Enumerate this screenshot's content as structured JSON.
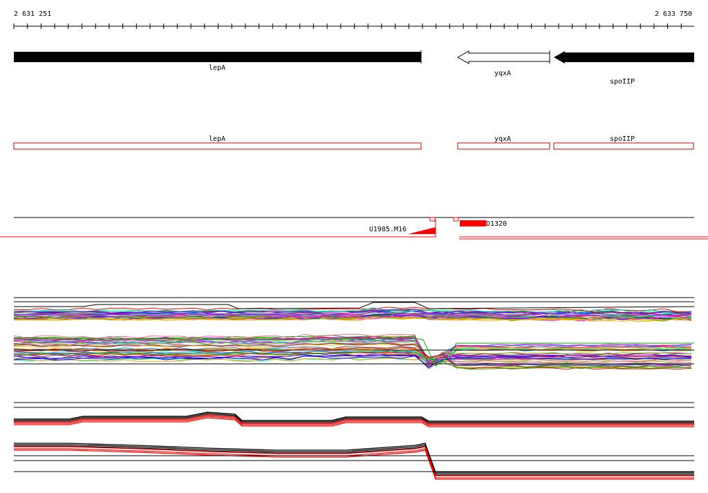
{
  "ruler": {
    "start_label": "2 631 251",
    "end_label": "2 633 750"
  },
  "genes": [
    {
      "name": "lepA",
      "strand": "+",
      "style": "filled"
    },
    {
      "name": "yqxA",
      "strand": "-",
      "style": "outline"
    },
    {
      "name": "spoIIP",
      "strand": "-",
      "style": "filled"
    }
  ],
  "cds_track": [
    {
      "name": "lepA"
    },
    {
      "name": "yqxA"
    },
    {
      "name": "spoIIP"
    }
  ],
  "features": [
    {
      "name": "U1985.M16",
      "shape": "ramp",
      "color": "#ff0000"
    },
    {
      "name": "D1320",
      "shape": "block",
      "color": "#ff0000"
    }
  ],
  "colors": {
    "gene_fill": "#000000",
    "cds_outline": "#cc0000",
    "feature": "#ff0000",
    "trace_black": "#000000",
    "trace_red": "#ff0000"
  }
}
